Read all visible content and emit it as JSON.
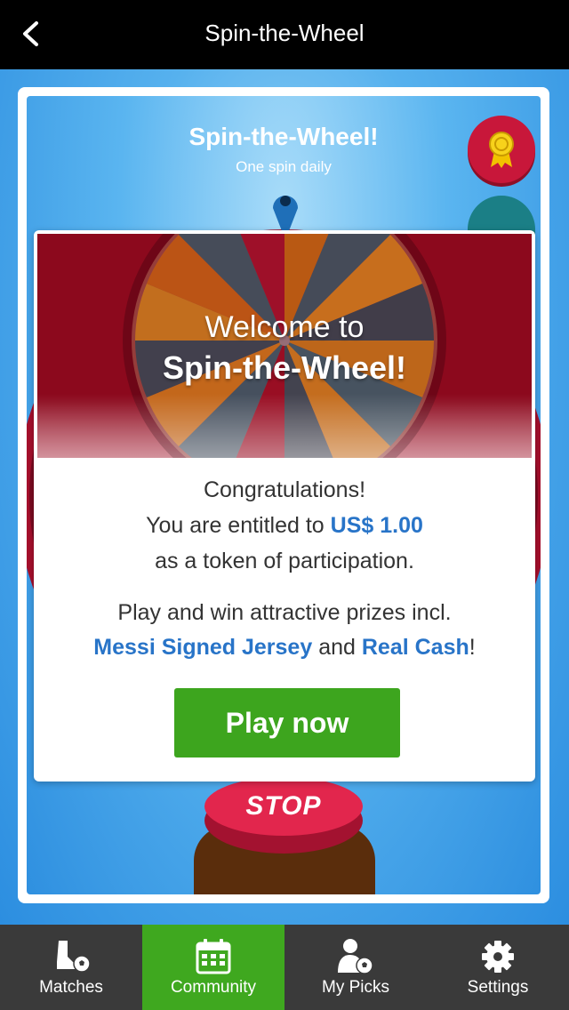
{
  "header": {
    "title": "Spin-the-Wheel",
    "back_icon": "chevron-left-icon"
  },
  "game": {
    "title": "Spin-the-Wheel!",
    "subtitle": "One spin daily",
    "award_icon": "ribbon-award-icon",
    "stop_label": "STOP"
  },
  "modal": {
    "banner_line1": "Welcome to",
    "banner_line2": "Spin-the-Wheel!",
    "congrats": "Congratulations!",
    "entitled_prefix": "You are entitled to ",
    "amount": "US$ 1.00",
    "token_text": "as a token of participation.",
    "prizes_intro": "Play and win attractive prizes incl.",
    "prize1": "Messi Signed Jersey",
    "and_text": " and ",
    "prize2": "Real Cash",
    "prize_suffix": "!",
    "play_button": "Play now"
  },
  "tabs": [
    {
      "label": "Matches",
      "icon": "cleat-ball-icon",
      "active": false
    },
    {
      "label": "Community",
      "icon": "calendar-icon",
      "active": true
    },
    {
      "label": "My Picks",
      "icon": "person-ball-icon",
      "active": false
    },
    {
      "label": "Settings",
      "icon": "gear-icon",
      "active": false
    }
  ],
  "colors": {
    "accent_green": "#3da51e",
    "highlight_blue": "#2874c8",
    "brand_red": "#8c0a1e"
  }
}
